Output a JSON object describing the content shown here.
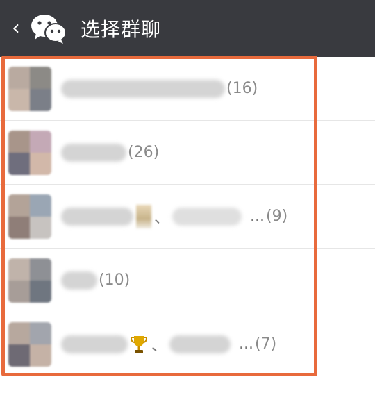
{
  "header": {
    "back_icon": "chevron-left-icon",
    "logo_icon": "wechat-logo-icon",
    "title": "选择群聊",
    "background": "#393a3f"
  },
  "highlight": {
    "color": "#e86a3c"
  },
  "groups": [
    {
      "count_label": "(16)"
    },
    {
      "count_label": "(26)"
    },
    {
      "count_label": "(9)",
      "ellipsis": "..."
    },
    {
      "count_label": "(10)"
    },
    {
      "count_label": "(7)",
      "ellipsis": "...",
      "emoji_icon": "trophy-icon"
    }
  ],
  "separator": "、"
}
